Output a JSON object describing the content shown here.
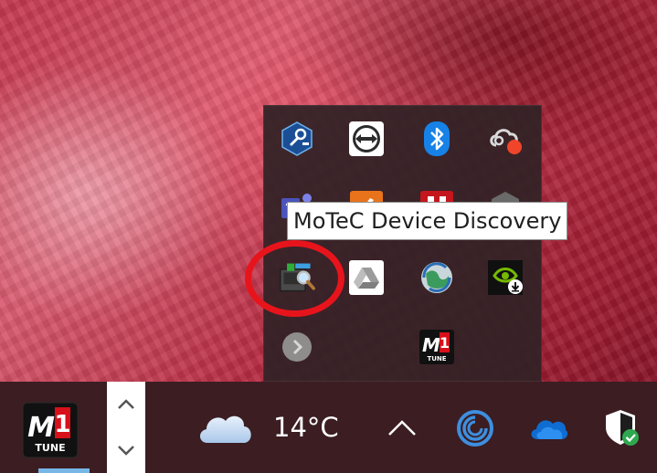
{
  "tooltip": {
    "text": "MoTeC Device Discovery"
  },
  "overflow_icons": [
    {
      "name": "network-tool-icon"
    },
    {
      "name": "teamviewer-icon"
    },
    {
      "name": "bluetooth-icon"
    },
    {
      "name": "creative-cloud-icon"
    },
    {
      "name": "teams-icon"
    },
    {
      "name": "orange-app-icon"
    },
    {
      "name": "red-app-icon"
    },
    {
      "name": "gray-app-icon"
    },
    {
      "name": "motec-device-discovery-icon"
    },
    {
      "name": "google-drive-icon"
    },
    {
      "name": "globe-sync-icon"
    },
    {
      "name": "nvidia-icon"
    },
    {
      "name": "gray-circle-arrow-icon"
    },
    {
      "name": "motec-m1-tune-icon"
    }
  ],
  "taskbar": {
    "app_icon": {
      "name": "motec-m1-tune-icon",
      "line1": "M",
      "line2": "1",
      "line3": "TUNE"
    },
    "scroll_up": "^",
    "scroll_down": "v",
    "weather": {
      "icon": "cloud-icon",
      "temperature": "14°C"
    },
    "tray": [
      {
        "name": "show-hidden-icons-chevron-icon"
      },
      {
        "name": "cortana-swirl-icon"
      },
      {
        "name": "onedrive-icon"
      },
      {
        "name": "windows-security-shield-icon"
      }
    ]
  },
  "colors": {
    "panel_bg": "#302226",
    "taskbar_bg": "#3b1d22",
    "highlight_ring": "#e8141c",
    "active_indicator": "#77b7e6"
  }
}
